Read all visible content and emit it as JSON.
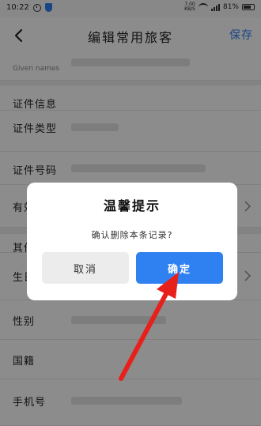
{
  "status_bar": {
    "time": "10:22",
    "net_top": "7.00",
    "net_unit": "KB/S",
    "battery": "81%",
    "icons": [
      "clock-icon",
      "shield-icon",
      "wifi-icon",
      "signal-icon",
      "battery-icon"
    ]
  },
  "header": {
    "title": "编辑常用旅客",
    "save_label": "保存",
    "back_icon": "back-chevron-icon"
  },
  "form": {
    "given_names_hint": "Given names",
    "id_info_label": "证件信息",
    "id_type_label": "证件类型",
    "id_number_label": "证件号码",
    "validity_label": "有效期",
    "other_label": "其他",
    "birth_label": "生日",
    "gender_label": "性别",
    "nationality_label": "国籍",
    "phone_label": "手机号"
  },
  "dialog": {
    "title": "温馨提示",
    "message": "确认删除本条记录?",
    "cancel_label": "取消",
    "confirm_label": "确定"
  },
  "colors": {
    "accent": "#2f80f0",
    "annotation_arrow": "#e8201c"
  }
}
